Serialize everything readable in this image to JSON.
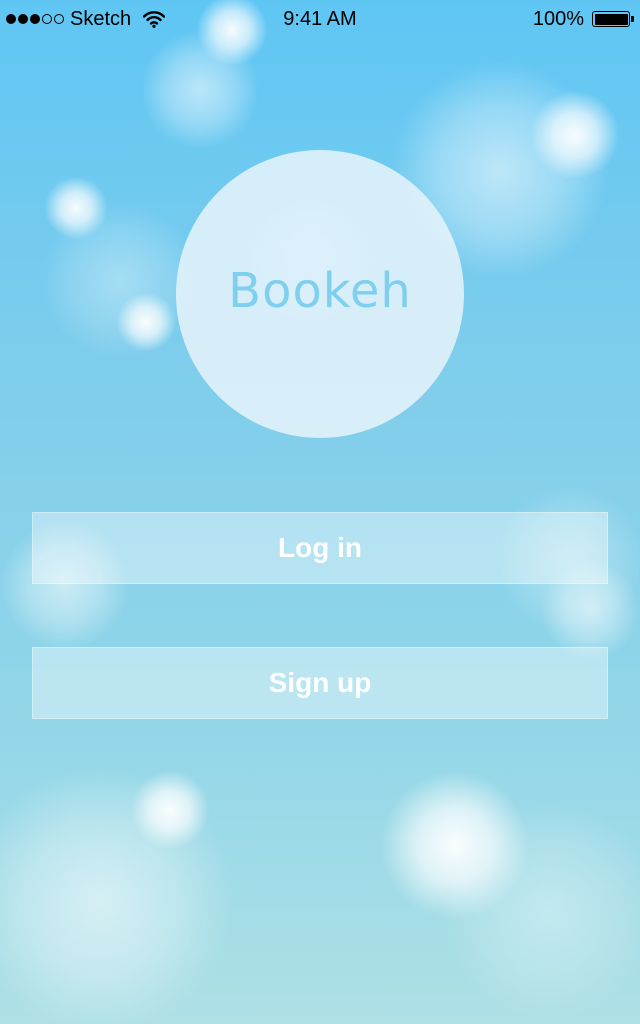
{
  "status_bar": {
    "signal_dots": [
      true,
      true,
      true,
      false,
      false
    ],
    "carrier": "Sketch",
    "wifi_icon": "wifi-icon",
    "time": "9:41 AM",
    "battery_percent": "100%",
    "battery_icon": "battery-icon",
    "battery_level": 1.0
  },
  "logo": {
    "text": "Bookeh",
    "text_color": "#7fcfee"
  },
  "buttons": {
    "login_label": "Log in",
    "signup_label": "Sign up"
  },
  "colors": {
    "background_top": "#5fc6f4",
    "background_bottom": "#aee0e6",
    "button_text": "#ffffff"
  }
}
